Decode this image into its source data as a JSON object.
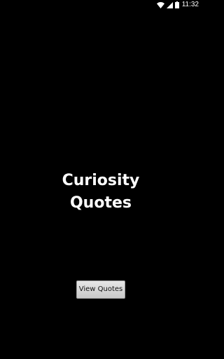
{
  "status_bar": {
    "time": "11:32",
    "icons": [
      "wifi-icon",
      "signal-icon",
      "battery-icon"
    ]
  },
  "main": {
    "title_line1": "Curiosity",
    "title_line2": "Quotes",
    "view_button_label": "View Quotes"
  },
  "colors": {
    "background": "#000000",
    "text": "#ffffff",
    "button": "#d6d6d6"
  }
}
